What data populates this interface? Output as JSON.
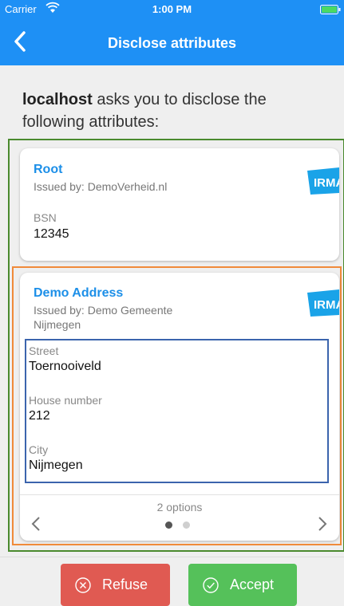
{
  "status_bar": {
    "carrier": "Carrier",
    "time": "1:00 PM"
  },
  "nav": {
    "title": "Disclose attributes"
  },
  "intro": {
    "host": "localhost",
    "text": " asks you to disclose the following attributes:"
  },
  "cards": [
    {
      "title": "Root",
      "issuer": "Issued by: DemoVerheid.nl",
      "logo": "IRMA",
      "attributes": [
        {
          "label": "BSN",
          "value": "12345"
        }
      ]
    },
    {
      "title": "Demo Address",
      "issuer": "Issued by: Demo Gemeente Nijmegen",
      "logo": "IRMA",
      "attributes": [
        {
          "label": "Street",
          "value": "Toernooiveld"
        },
        {
          "label": "House number",
          "value": "212"
        },
        {
          "label": "City",
          "value": "Nijmegen"
        }
      ],
      "options_text": "2 options",
      "selected_option": 1
    }
  ],
  "buttons": {
    "refuse": "Refuse",
    "accept": "Accept"
  },
  "colors": {
    "header": "#1e90f5",
    "title_blue": "#1c8fe8",
    "refuse": "#e05a52",
    "accept": "#55c15a",
    "outline_green": "#4a8a2e",
    "outline_orange": "#f08a3a",
    "outline_blue": "#3b64ad"
  }
}
